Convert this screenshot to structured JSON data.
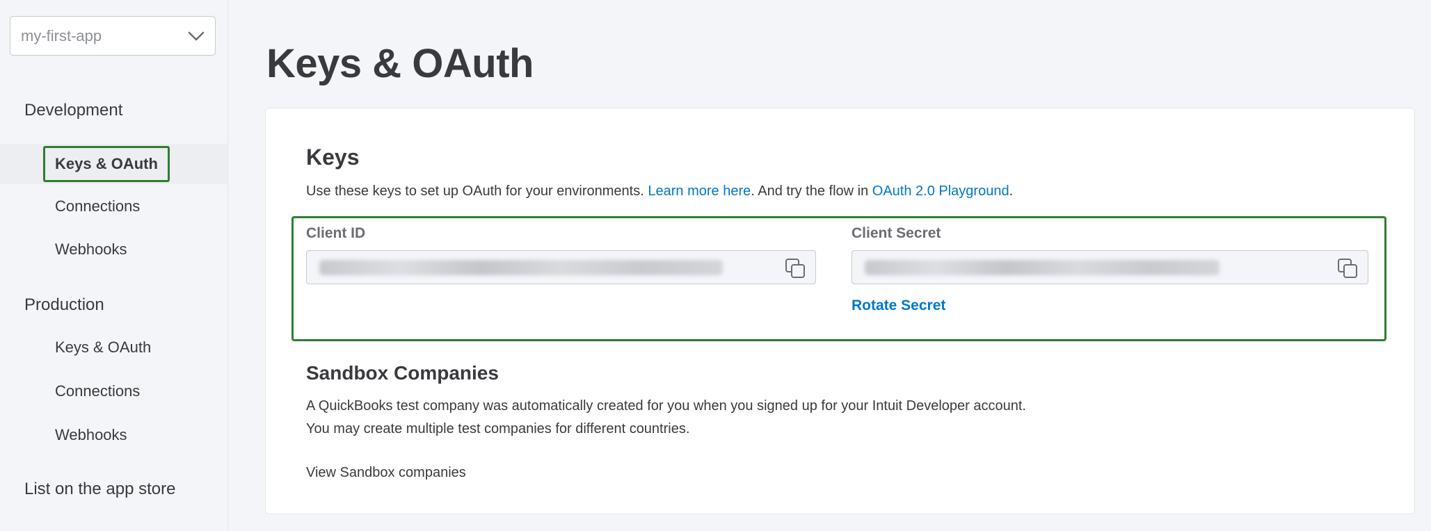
{
  "sidebar": {
    "app_select": {
      "value": "my-first-app",
      "icon": "chevron-down-icon"
    },
    "development_label": "Development",
    "development_items": [
      {
        "label": "Keys & OAuth",
        "active": true
      },
      {
        "label": "Connections",
        "active": false
      },
      {
        "label": "Webhooks",
        "active": false
      }
    ],
    "production_label": "Production",
    "production_items": [
      {
        "label": "Keys & OAuth"
      },
      {
        "label": "Connections"
      },
      {
        "label": "Webhooks"
      }
    ],
    "app_store_label": "List on the app store"
  },
  "main": {
    "title": "Keys & OAuth",
    "keys": {
      "heading": "Keys",
      "desc_prefix": "Use these keys to set up OAuth for your environments. ",
      "learn_more": "Learn more here",
      "desc_middle": ". And try the flow in ",
      "playground": "OAuth 2.0 Playground",
      "desc_suffix": ".",
      "client_id_label": "Client ID",
      "client_secret_label": "Client Secret",
      "copy_icon": "copy-icon",
      "rotate_secret": "Rotate Secret"
    },
    "sandbox": {
      "heading": "Sandbox Companies",
      "line1": "A QuickBooks test company was automatically created for you when you signed up for your Intuit Developer account.",
      "line2": "You may create multiple test companies for different countries.",
      "view_link": "View Sandbox companies"
    }
  },
  "colors": {
    "accent_link": "#0077c5",
    "highlight_border": "#2e7d32",
    "background": "#f4f5f8",
    "text": "#393a3d"
  }
}
